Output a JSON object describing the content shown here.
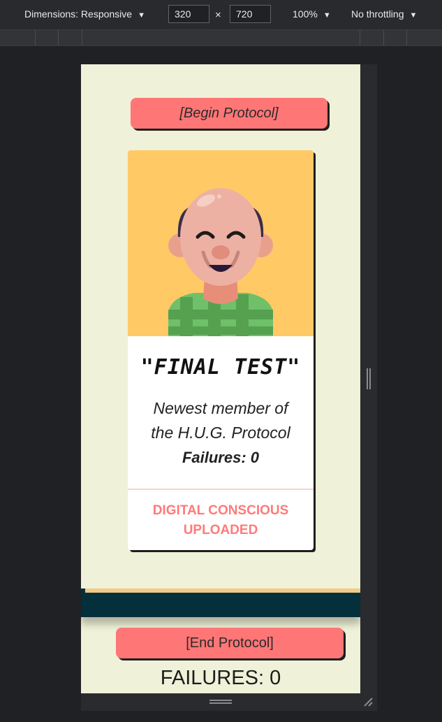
{
  "devtools": {
    "dimensions_label": "Dimensions: Responsive",
    "width_value": "320",
    "height_value": "720",
    "times_symbol": "×",
    "zoom_label": "100%",
    "throttle_label": "No throttling",
    "caret": "▼"
  },
  "page": {
    "begin_button": "[Begin Protocol]",
    "card": {
      "title": "\"FINAL TEST\"",
      "description": "Newest member of the H.U.G. Protocol",
      "failures": "Failures: 0",
      "status": "DIGITAL CONSCIOUS UPLOADED"
    },
    "end_button": "[End Protocol]",
    "failures_total": "FAILURES: 0"
  },
  "colors": {
    "page_background": "#eff1d8",
    "button": "#ff7676",
    "portrait_background": "#ffc966",
    "status_text": "#ff7a7a",
    "dark_band": "#03303a"
  },
  "icons": [
    "caret-down-icon",
    "resize-grip-icon",
    "resize-corner-icon",
    "avatar-illustration"
  ]
}
